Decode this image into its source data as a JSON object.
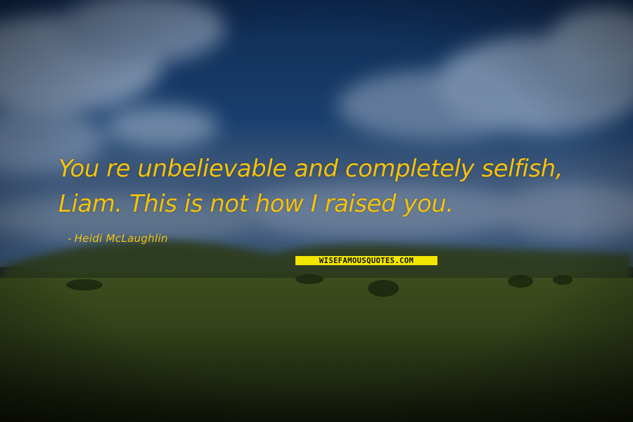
{
  "quote": {
    "line1": "You   re unbelievable and completely selfish,",
    "line2": "Liam. This is not how I raised you."
  },
  "author": {
    "dash": "-",
    "name": "Heidi McLaughlin"
  },
  "watermark": "WISEFAMOUSQUOTES.COM",
  "colors": {
    "text": "#f4c20d",
    "watermark_bg": "#f2e600"
  }
}
